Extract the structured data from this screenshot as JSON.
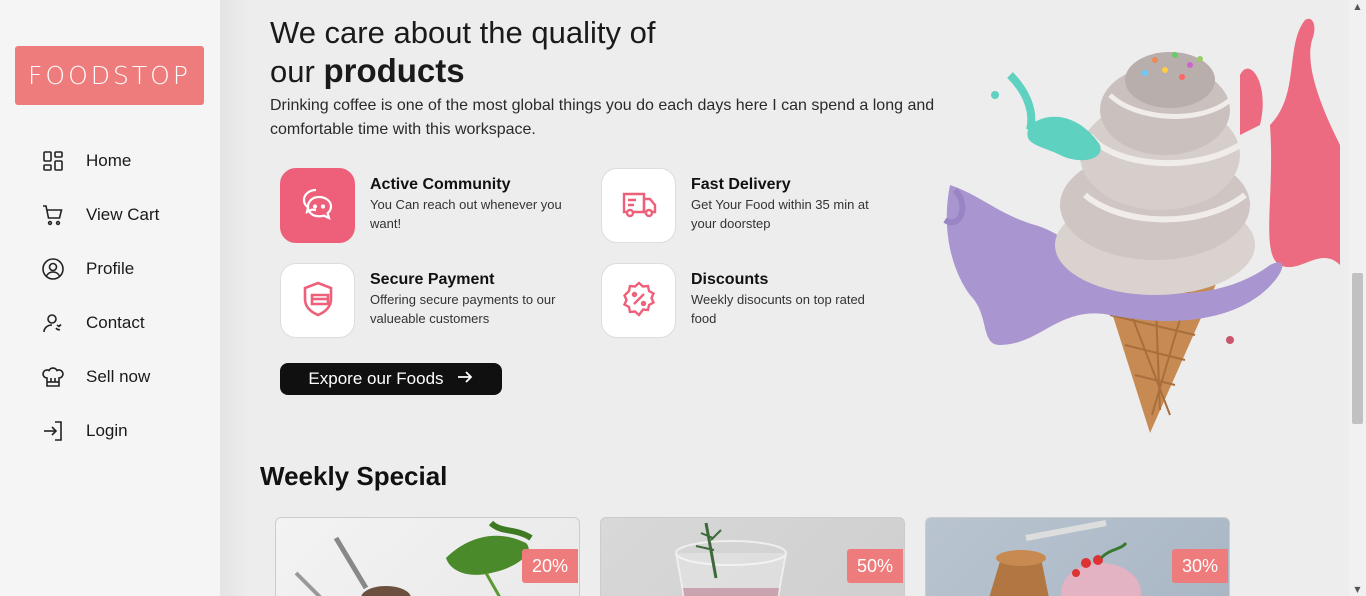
{
  "brand": {
    "logo_text": "FOODSTOP",
    "accent": "#ef7c7c",
    "pink": "#ee6079"
  },
  "sidebar": {
    "items": [
      {
        "label": "Home",
        "icon": "grid-icon"
      },
      {
        "label": "View Cart",
        "icon": "cart-icon"
      },
      {
        "label": "Profile",
        "icon": "user-circle-icon"
      },
      {
        "label": "Contact",
        "icon": "contact-icon"
      },
      {
        "label": "Sell now",
        "icon": "chef-hat-icon"
      },
      {
        "label": "Login",
        "icon": "login-icon"
      }
    ]
  },
  "hero": {
    "title_line1": "We care about the quality of",
    "title_line2_prefix": "our",
    "title_line2_bold": "products",
    "description": "Drinking coffee is one of the most global things you do each days here I can spend a long and comfortable time with this workspace."
  },
  "features": [
    {
      "title": "Active Community",
      "subtitle": "You Can reach out whenever you want!",
      "icon": "chat-icon"
    },
    {
      "title": "Fast Delivery",
      "subtitle": "Get Your Food within 35 min at your doorstep",
      "icon": "truck-icon"
    },
    {
      "title": "Secure Payment",
      "subtitle": "Offering secure payments to our valueable customers",
      "icon": "shield-card-icon"
    },
    {
      "title": "Discounts",
      "subtitle": "Weekly disocunts on top rated food",
      "icon": "discount-icon"
    }
  ],
  "explore_button": {
    "label": "Expore our Foods"
  },
  "weekly": {
    "title": "Weekly Special",
    "cards": [
      {
        "discount": "20%"
      },
      {
        "discount": "50%"
      },
      {
        "discount": "30%"
      }
    ]
  }
}
